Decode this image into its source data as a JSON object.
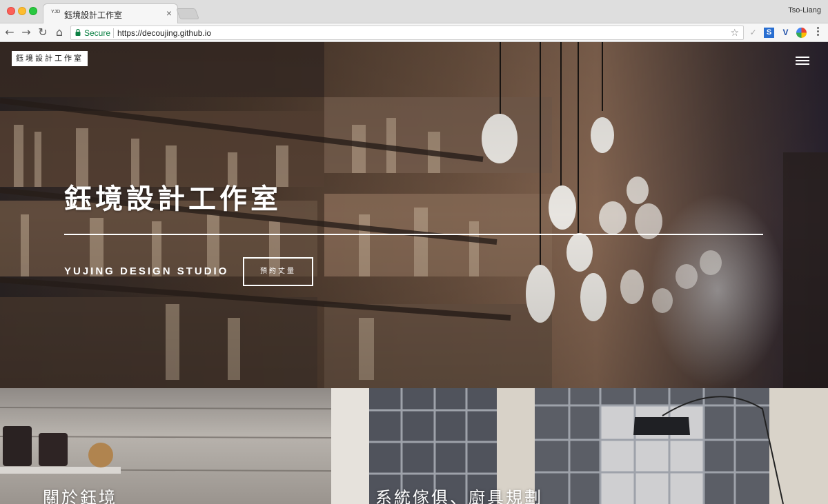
{
  "browser": {
    "tab": {
      "favicon_text": "YJD",
      "title": "鈺境設計工作室",
      "close_glyph": "×"
    },
    "profile_name": "Tso-Liang",
    "toolbar": {
      "back_glyph": "←",
      "forward_glyph": "→",
      "reload_glyph": "↻",
      "home_glyph": "⌂",
      "secure_label": "Secure",
      "url": "https://decoujing.github.io",
      "bookmark_glyph": "☆"
    },
    "extensions": [
      "check-icon",
      "s-extension-icon",
      "v-extension-icon",
      "color-wheel-icon"
    ]
  },
  "site": {
    "logo": "鈺境設計工作室",
    "hero": {
      "title": "鈺境設計工作室",
      "subtitle": "YUJING DESIGN STUDIO",
      "cta_label": "預約丈量"
    },
    "panels": [
      {
        "title": "關於鈺境"
      },
      {
        "title": "系統傢俱、廚具規劃"
      }
    ]
  },
  "colors": {
    "secure_green": "#0b8043",
    "hero_text": "#ffffff",
    "logo_bg": "#ffffff"
  }
}
